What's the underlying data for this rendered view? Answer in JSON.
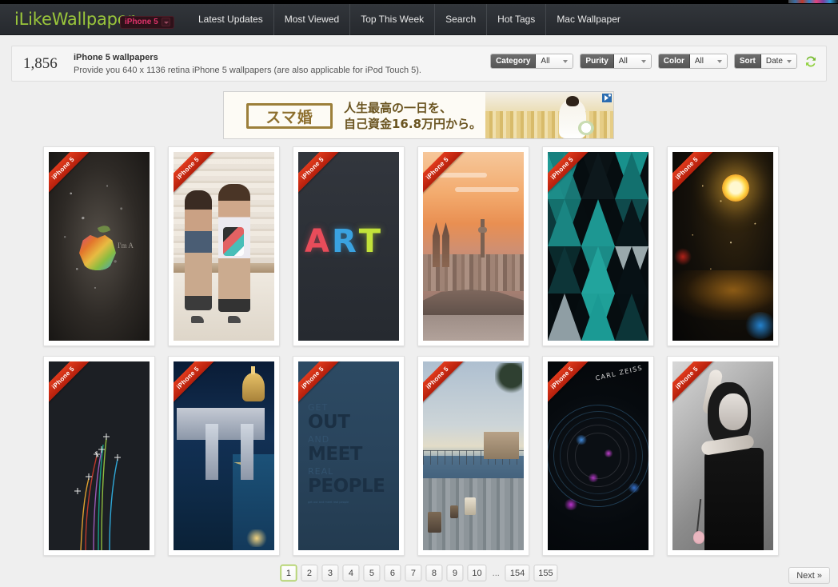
{
  "header": {
    "logo": "iLikeWallpaper",
    "device_badge": "iPhone 5",
    "nav": [
      {
        "label": "Latest Updates"
      },
      {
        "label": "Most Viewed"
      },
      {
        "label": "Top This Week"
      },
      {
        "label": "Search"
      },
      {
        "label": "Hot Tags"
      },
      {
        "label": "Mac Wallpaper"
      }
    ]
  },
  "info": {
    "count": "1,856",
    "title": "iPhone 5 wallpapers",
    "description": "Provide you 640 x 1136 retina iPhone 5 wallpapers (are also applicable for iPod Touch 5)."
  },
  "filters": [
    {
      "label": "Category",
      "value": "All"
    },
    {
      "label": "Purity",
      "value": "All"
    },
    {
      "label": "Color",
      "value": "All"
    },
    {
      "label": "Sort",
      "value": "Date"
    }
  ],
  "refresh_icon": "refresh-icon",
  "ad": {
    "logo_text": "スマ婚",
    "line1": "人生最高の一日を、",
    "line2": "自己資金16.8万円から。",
    "adchoices": "AdChoices"
  },
  "gallery": {
    "ribbon_label": "iPhone 5",
    "items": [
      {
        "name": "apple-splatter-wallpaper",
        "art": "w-apple",
        "caption": "I'm A"
      },
      {
        "name": "two-women-fashion-wallpaper",
        "art": "w-women",
        "caption": ""
      },
      {
        "name": "art-typography-wallpaper",
        "art": "w-art",
        "caption": "ART"
      },
      {
        "name": "cologne-sunset-cityscape-wallpaper",
        "art": "w-cologne",
        "caption": ""
      },
      {
        "name": "teal-triangles-geometric-wallpaper",
        "art": "w-tri",
        "caption": ""
      },
      {
        "name": "golden-sun-water-bokeh-wallpaper",
        "art": "w-sun",
        "caption": ""
      },
      {
        "name": "minimal-colored-lines-wallpaper",
        "art": "w-lines",
        "caption": ""
      },
      {
        "name": "budapest-night-bridge-wallpaper",
        "art": "w-buda",
        "caption": ""
      },
      {
        "name": "get-out-meet-real-people-wallpaper",
        "art": "w-getout",
        "caption": "GET OUT AND MEET REAL PEOPLE"
      },
      {
        "name": "seaside-pier-lanterns-wallpaper",
        "art": "w-pier",
        "caption": ""
      },
      {
        "name": "carl-zeiss-camera-lens-wallpaper",
        "art": "w-lens",
        "caption": "CARL ZEISS"
      },
      {
        "name": "black-white-portrait-rose-wallpaper",
        "art": "w-bw",
        "caption": ""
      }
    ]
  },
  "getout_poster": {
    "l1": "GET",
    "l2": "OUT",
    "l3": "AND",
    "l4": "MEET",
    "l5": "REAL",
    "l6": "PEOPLE",
    "footnote": "get out and meet real people"
  },
  "lens_poster": {
    "brand": "CARL ZEISS"
  },
  "art_poster": {
    "a": "A",
    "r": "R",
    "t": "T"
  },
  "pagination": {
    "pages": [
      "1",
      "2",
      "3",
      "4",
      "5",
      "6",
      "7",
      "8",
      "9",
      "10"
    ],
    "ellipsis": "...",
    "tail_pages": [
      "154",
      "155"
    ],
    "active": "1",
    "next_label": "Next »"
  },
  "colors": {
    "logo_green": "#9ac63b",
    "badge_pink": "#e0336b",
    "ribbon_red": "#c9280f",
    "header_bg": "#2a2e33",
    "page_bg": "#efefef"
  }
}
